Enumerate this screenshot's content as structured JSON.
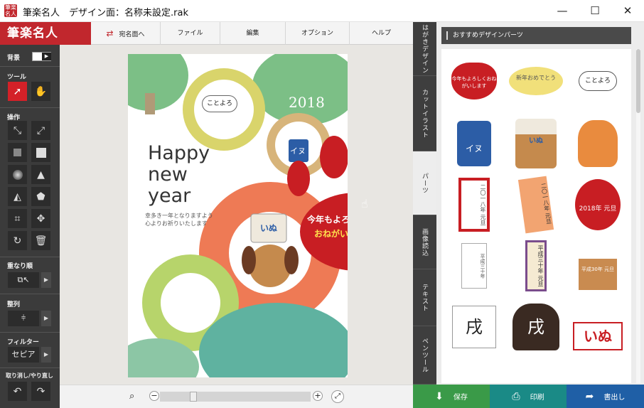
{
  "window": {
    "title": "筆楽名人　デザイン面：名称未設定.rak",
    "app_icon_text": "筆楽名人",
    "minimize": "—",
    "maximize": "☐",
    "close": "✕"
  },
  "logo": "筆楽名人",
  "menu": {
    "items": [
      "宛名面へ",
      "ファイル",
      "編集",
      "オプション",
      "ヘルプ"
    ]
  },
  "left_panel": {
    "background_label": "背景",
    "tools_label": "ツール",
    "operations_label": "操作",
    "stack_order_label": "重なり順",
    "align_label": "整列",
    "filter_label": "フィルター",
    "filter_value": "セピア",
    "undo_redo_label": "取り消し/やり直し"
  },
  "card": {
    "year": "2018",
    "greeting_line1": "Happy",
    "greeting_line2": "new",
    "greeting_line3": "year",
    "message_line1": "幸多き一年となりますよう",
    "message_line2": "心よりお祈りいたします",
    "bubble_text": "ことよろ",
    "dog_banner_text": "イヌ",
    "hat_text": "いぬ",
    "paw_line1": "今年もよろしく",
    "paw_line2": "おねがいします"
  },
  "vertical_tabs": [
    "はがきデザイン",
    "カットイラスト",
    "パーツ",
    "画像読込",
    "テキスト",
    "ペンツール"
  ],
  "right_panel": {
    "header": "おすすめデザインパーツ",
    "parts": [
      {
        "name": "paw-sticker",
        "text": "今年もよろしくおねがいします"
      },
      {
        "name": "new-year-bubble",
        "text": "新年おめでとう"
      },
      {
        "name": "kotoyoro-bubble",
        "text": "ことよろ"
      },
      {
        "name": "inu-shirt-dog",
        "text": "イヌ"
      },
      {
        "name": "chef-dog",
        "text": "いぬ"
      },
      {
        "name": "fox-dog-fan",
        "text": ""
      },
      {
        "name": "red-frame-plaque",
        "text": "二〇一八年 元旦"
      },
      {
        "name": "scroll-plaque",
        "text": "二〇一八年 元旦"
      },
      {
        "name": "daruma-2018",
        "text": "2018年 元旦"
      },
      {
        "name": "tag-heisei",
        "text": "平成三十年"
      },
      {
        "name": "hanging-scroll",
        "text": "平成三十年 元旦"
      },
      {
        "name": "kagami-mochi",
        "text": "平成30年 元旦"
      },
      {
        "name": "calligraphy-dog",
        "text": "戌"
      },
      {
        "name": "black-dog-kanji",
        "text": "戌"
      },
      {
        "name": "two-dogs-inu",
        "text": "いぬ"
      }
    ]
  },
  "bottom_buttons": {
    "save": "保存",
    "print": "印刷",
    "export": "書出し"
  },
  "colors": {
    "brand_red": "#c1272d",
    "save_green": "#3a9a48",
    "print_teal": "#1a8a86",
    "export_blue": "#1f5fa6"
  }
}
